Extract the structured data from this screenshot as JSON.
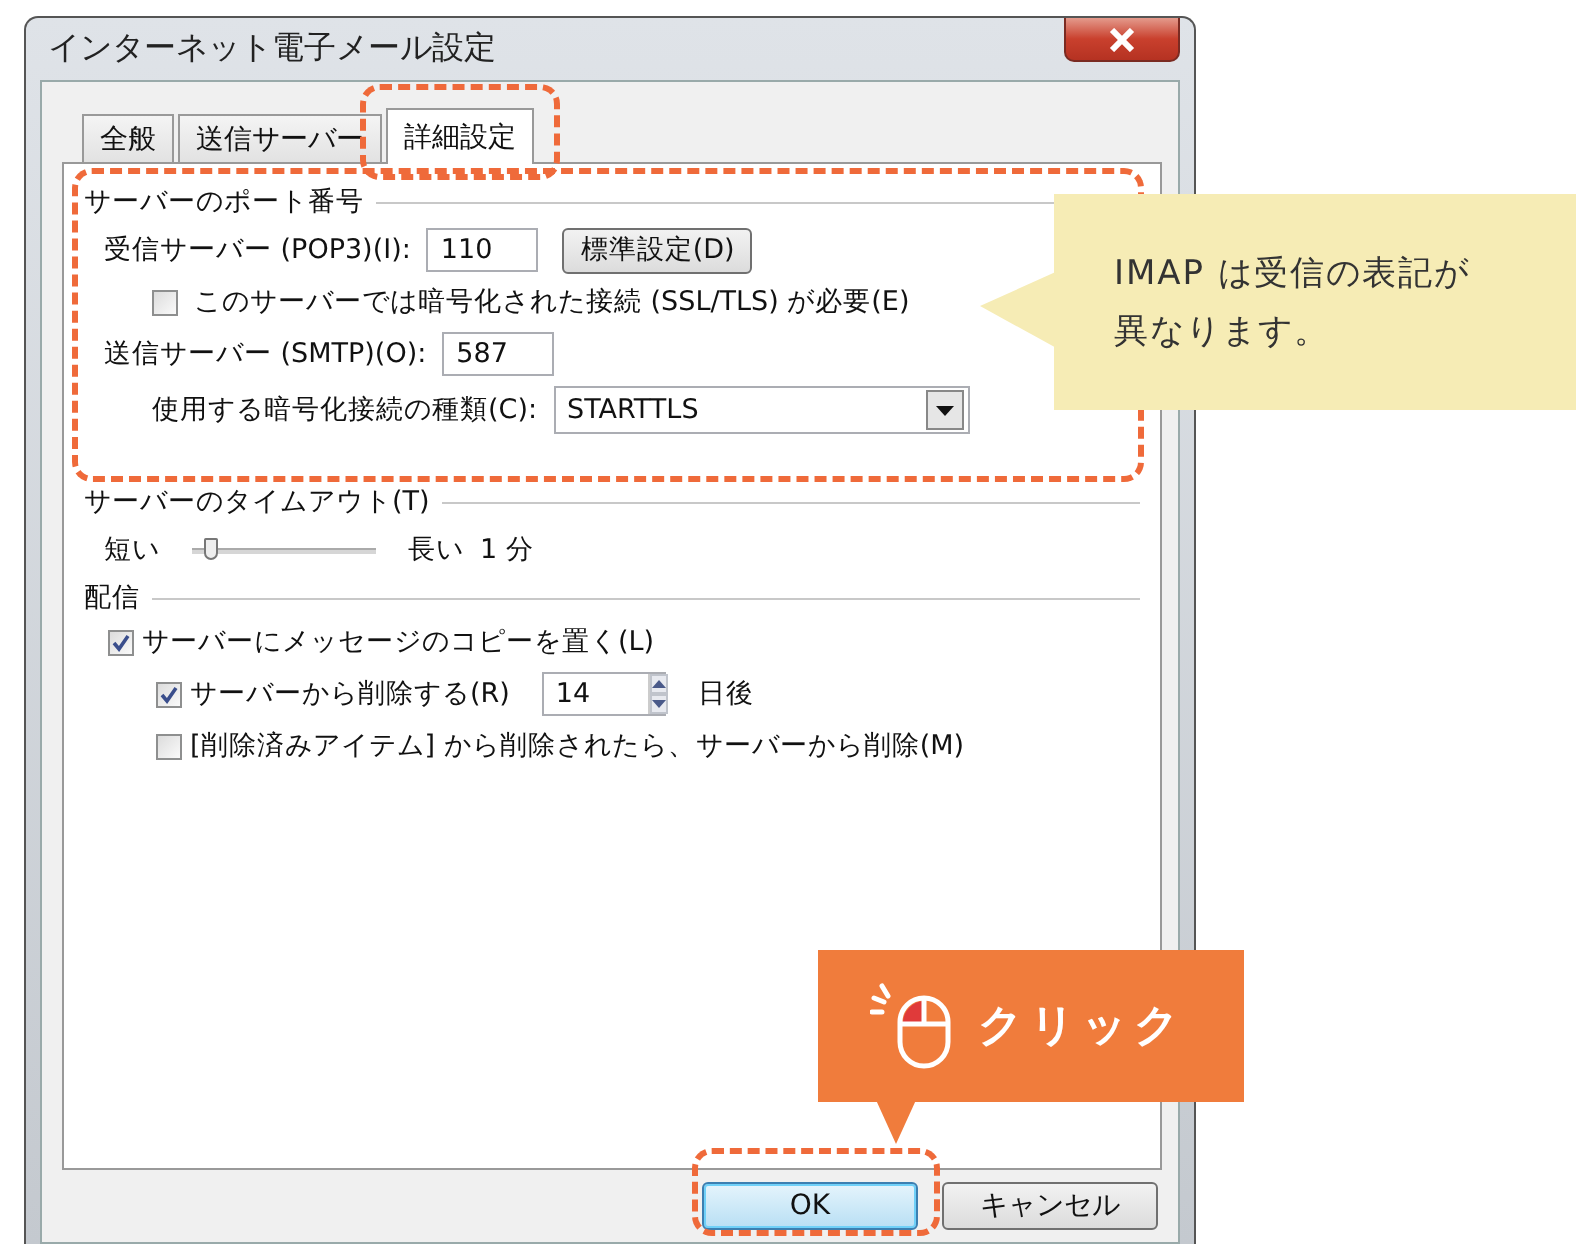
{
  "window": {
    "title": "インターネット電子メール設定"
  },
  "tabs": [
    {
      "label": "全般",
      "selected": false
    },
    {
      "label": "送信サーバー",
      "selected": false
    },
    {
      "label": "詳細設定",
      "selected": true
    }
  ],
  "port_group": {
    "title": "サーバーのポート番号",
    "incoming_label": "受信サーバー (POP3)(I):",
    "incoming_value": "110",
    "default_button": "標準設定(D)",
    "ssl": {
      "label": "このサーバーでは暗号化された接続 (SSL/TLS) が必要(E)",
      "checked": false
    },
    "outgoing_label": "送信サーバー (SMTP)(O):",
    "outgoing_value": "587",
    "encryption_label": "使用する暗号化接続の種類(C):",
    "encryption_value": "STARTTLS"
  },
  "timeout": {
    "title": "サーバーのタイムアウト(T)",
    "short_label": "短い",
    "level": 0.1,
    "long_label": "長い",
    "value": "1 分"
  },
  "delivery": {
    "title": "配信",
    "leave_copy": {
      "label": "サーバーにメッセージのコピーを置く(L)",
      "checked": true
    },
    "delete_after": {
      "label": "サーバーから削除する(R)",
      "checked": true,
      "days": "14",
      "unit": "日後"
    },
    "delete_when_deleted": {
      "label": "[削除済みアイテム] から削除されたら、サーバーから削除(M)",
      "checked": false
    }
  },
  "buttons": [
    {
      "label": "OK",
      "kind": "default"
    },
    {
      "label": "キャンセル",
      "kind": "normal"
    }
  ],
  "annotations": {
    "note_lines": [
      "IMAP は受信の表記が",
      "異なります。"
    ],
    "click": "クリック"
  }
}
